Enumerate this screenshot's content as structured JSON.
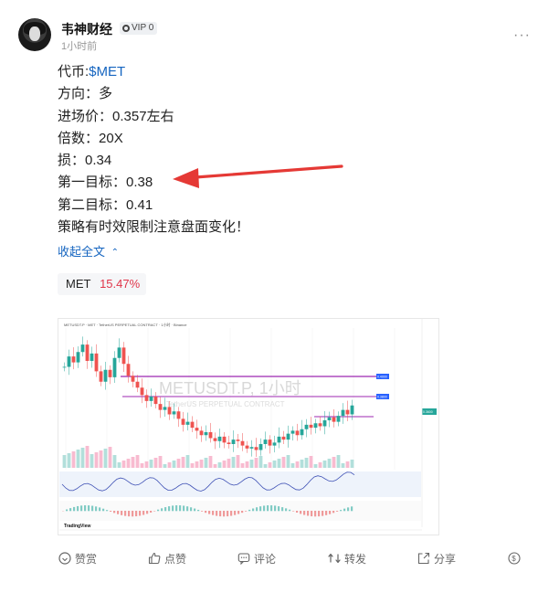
{
  "post": {
    "author": "韦神财经",
    "badge": "VIP 0",
    "time": "1小时前",
    "menu": "···",
    "lines": [
      {
        "label": "代币:",
        "value": "$MET"
      },
      {
        "label": "方向：",
        "value": "多"
      },
      {
        "label": "进场价：",
        "value": "0.357左右"
      },
      {
        "label": "倍数：",
        "value": "20X"
      },
      {
        "label": "损：",
        "value": "0.34"
      },
      {
        "label": "第一目标：",
        "value": "0.38"
      },
      {
        "label": "第二目标：",
        "value": "0.41"
      },
      {
        "label": "策略有时效限制注意盘面变化！",
        "value": ""
      }
    ],
    "collapse_label": "收起全文",
    "collapse_chevron": "^",
    "chip": {
      "symbol": "MET",
      "change": "15.47%"
    }
  },
  "chart_image": {
    "header": "METUSDT.P · MET · TetherUS PERPETUAL CONTRACT · 1小时 · Binance",
    "watermark_title": "METUSDT.P, 1小时",
    "watermark_sub": "TetherUS PERPETUAL CONTRACT",
    "logo": "TradingView",
    "levels_label_top": "0.4000",
    "levels_label_mid": "0.3800",
    "price_tag": "0.3600",
    "candles": [
      0.395,
      0.402,
      0.398,
      0.405,
      0.41,
      0.399,
      0.404,
      0.392,
      0.385,
      0.393,
      0.388,
      0.401,
      0.408,
      0.397,
      0.389,
      0.385,
      0.381,
      0.376,
      0.372,
      0.375,
      0.37,
      0.366,
      0.368,
      0.363,
      0.365,
      0.36,
      0.356,
      0.358,
      0.354,
      0.352,
      0.349,
      0.351,
      0.347,
      0.345,
      0.348,
      0.344,
      0.343,
      0.346,
      0.345,
      0.342,
      0.34,
      0.341,
      0.339,
      0.343,
      0.346,
      0.342,
      0.344,
      0.348,
      0.346,
      0.35,
      0.352,
      0.349,
      0.353,
      0.356,
      0.354,
      0.357,
      0.355,
      0.359,
      0.361,
      0.358,
      0.362,
      0.366,
      0.363,
      0.369
    ]
  },
  "actions": [
    {
      "name": "reward",
      "label": "赞赏"
    },
    {
      "name": "like",
      "label": "点赞"
    },
    {
      "name": "comment",
      "label": "评论"
    },
    {
      "name": "repost",
      "label": "转发"
    },
    {
      "name": "share",
      "label": "分享"
    }
  ],
  "colors": {
    "link": "#1565c0",
    "gain": "#e0354a",
    "arrow": "#e53935",
    "level": "#9c27b0",
    "up_candle": "#26a69a",
    "down_candle": "#ef5350"
  }
}
